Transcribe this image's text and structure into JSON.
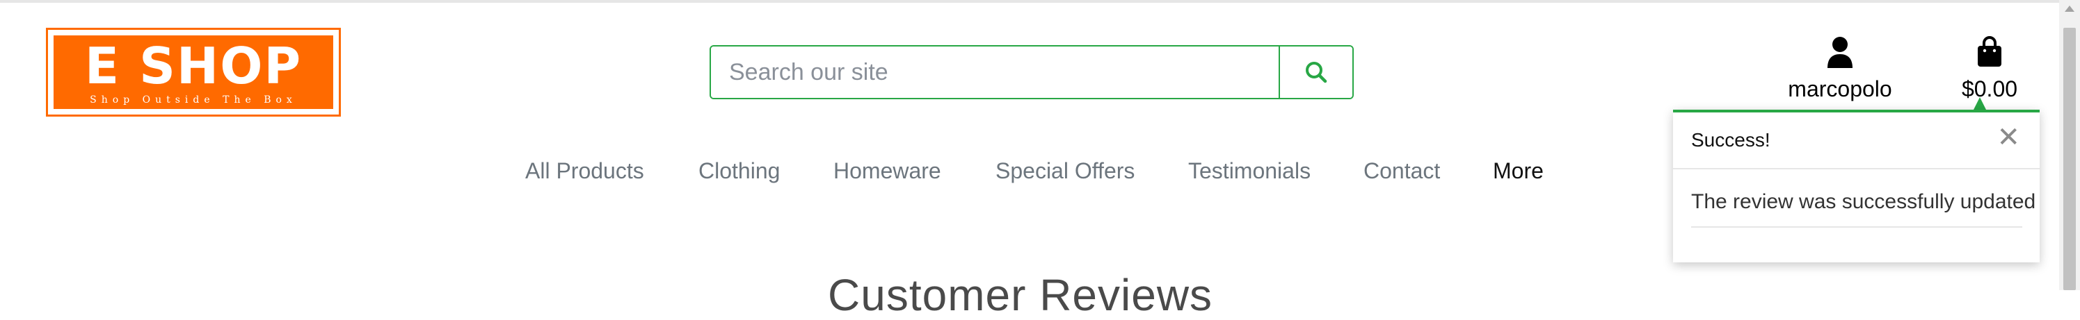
{
  "logo": {
    "title": "E SHOP",
    "tagline": "Shop Outside The Box"
  },
  "search": {
    "placeholder": "Search our site",
    "value": ""
  },
  "header": {
    "account_label": "marcopolo",
    "bag_total": "$0.00"
  },
  "nav": {
    "items": [
      {
        "label": "All Products"
      },
      {
        "label": "Clothing"
      },
      {
        "label": "Homeware"
      },
      {
        "label": "Special Offers"
      },
      {
        "label": "Testimonials"
      },
      {
        "label": "Contact"
      },
      {
        "label": "More"
      }
    ]
  },
  "page": {
    "heading": "Customer Reviews"
  },
  "toast": {
    "title": "Success!",
    "close": "✕",
    "message": "The review was successfully updated"
  },
  "colors": {
    "brand": "#ff6a00",
    "success": "#28a745",
    "nav_text": "#6c757d"
  },
  "icons": {
    "search": "search-icon",
    "account": "user-icon",
    "bag": "shopping-bag-icon",
    "close": "close-icon"
  }
}
